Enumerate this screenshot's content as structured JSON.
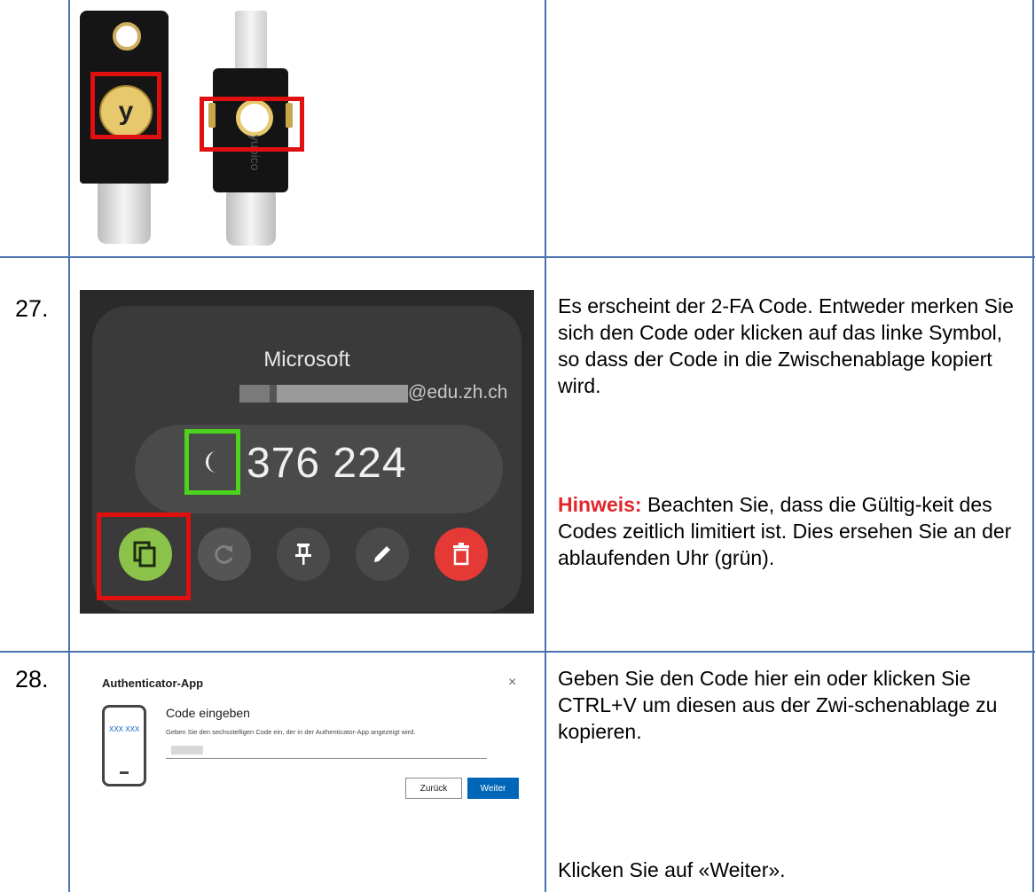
{
  "rows": [
    {
      "step": ""
    },
    {
      "step": "27.",
      "text": "Es erscheint der 2-FA Code. Entweder merken Sie sich den Code oder klicken auf das linke Symbol, so dass der Code in die Zwischenablage kopiert wird.",
      "hint_label": "Hinweis:",
      "hint_text": " Beachten Sie, dass die Gültig-keit des Codes zeitlich limitiert ist. Dies ersehen Sie an der ablaufenden Uhr (grün)."
    },
    {
      "step": "28.",
      "text": "Geben Sie den Code hier ein oder klicken Sie CTRL+V um diesen aus der Zwi-schenablage zu kopieren.",
      "text2": "Klicken Sie auf «Weiter»."
    }
  ],
  "yubikey": {
    "logo_letter": "y",
    "brand": "yubico"
  },
  "authenticator": {
    "issuer": "Microsoft",
    "account_domain": "@edu.zh.ch",
    "code": "376 224",
    "buttons": [
      "copy-icon",
      "refresh-icon",
      "pin-icon",
      "edit-icon",
      "delete-icon"
    ],
    "colors": {
      "copy": "#8bc34a",
      "delete": "#e53935",
      "timer_box": "#4dd21d",
      "highlight": "#e01010"
    }
  },
  "dialog": {
    "title": "Authenticator-App",
    "close": "×",
    "phone_code": "XXX XXX",
    "heading": "Code eingeben",
    "subtext": "Geben Sie den sechsstelligen Code ein, der in der Authenticator-App angezeigt wird.",
    "back_label": "Zurück",
    "next_label": "Weiter"
  }
}
